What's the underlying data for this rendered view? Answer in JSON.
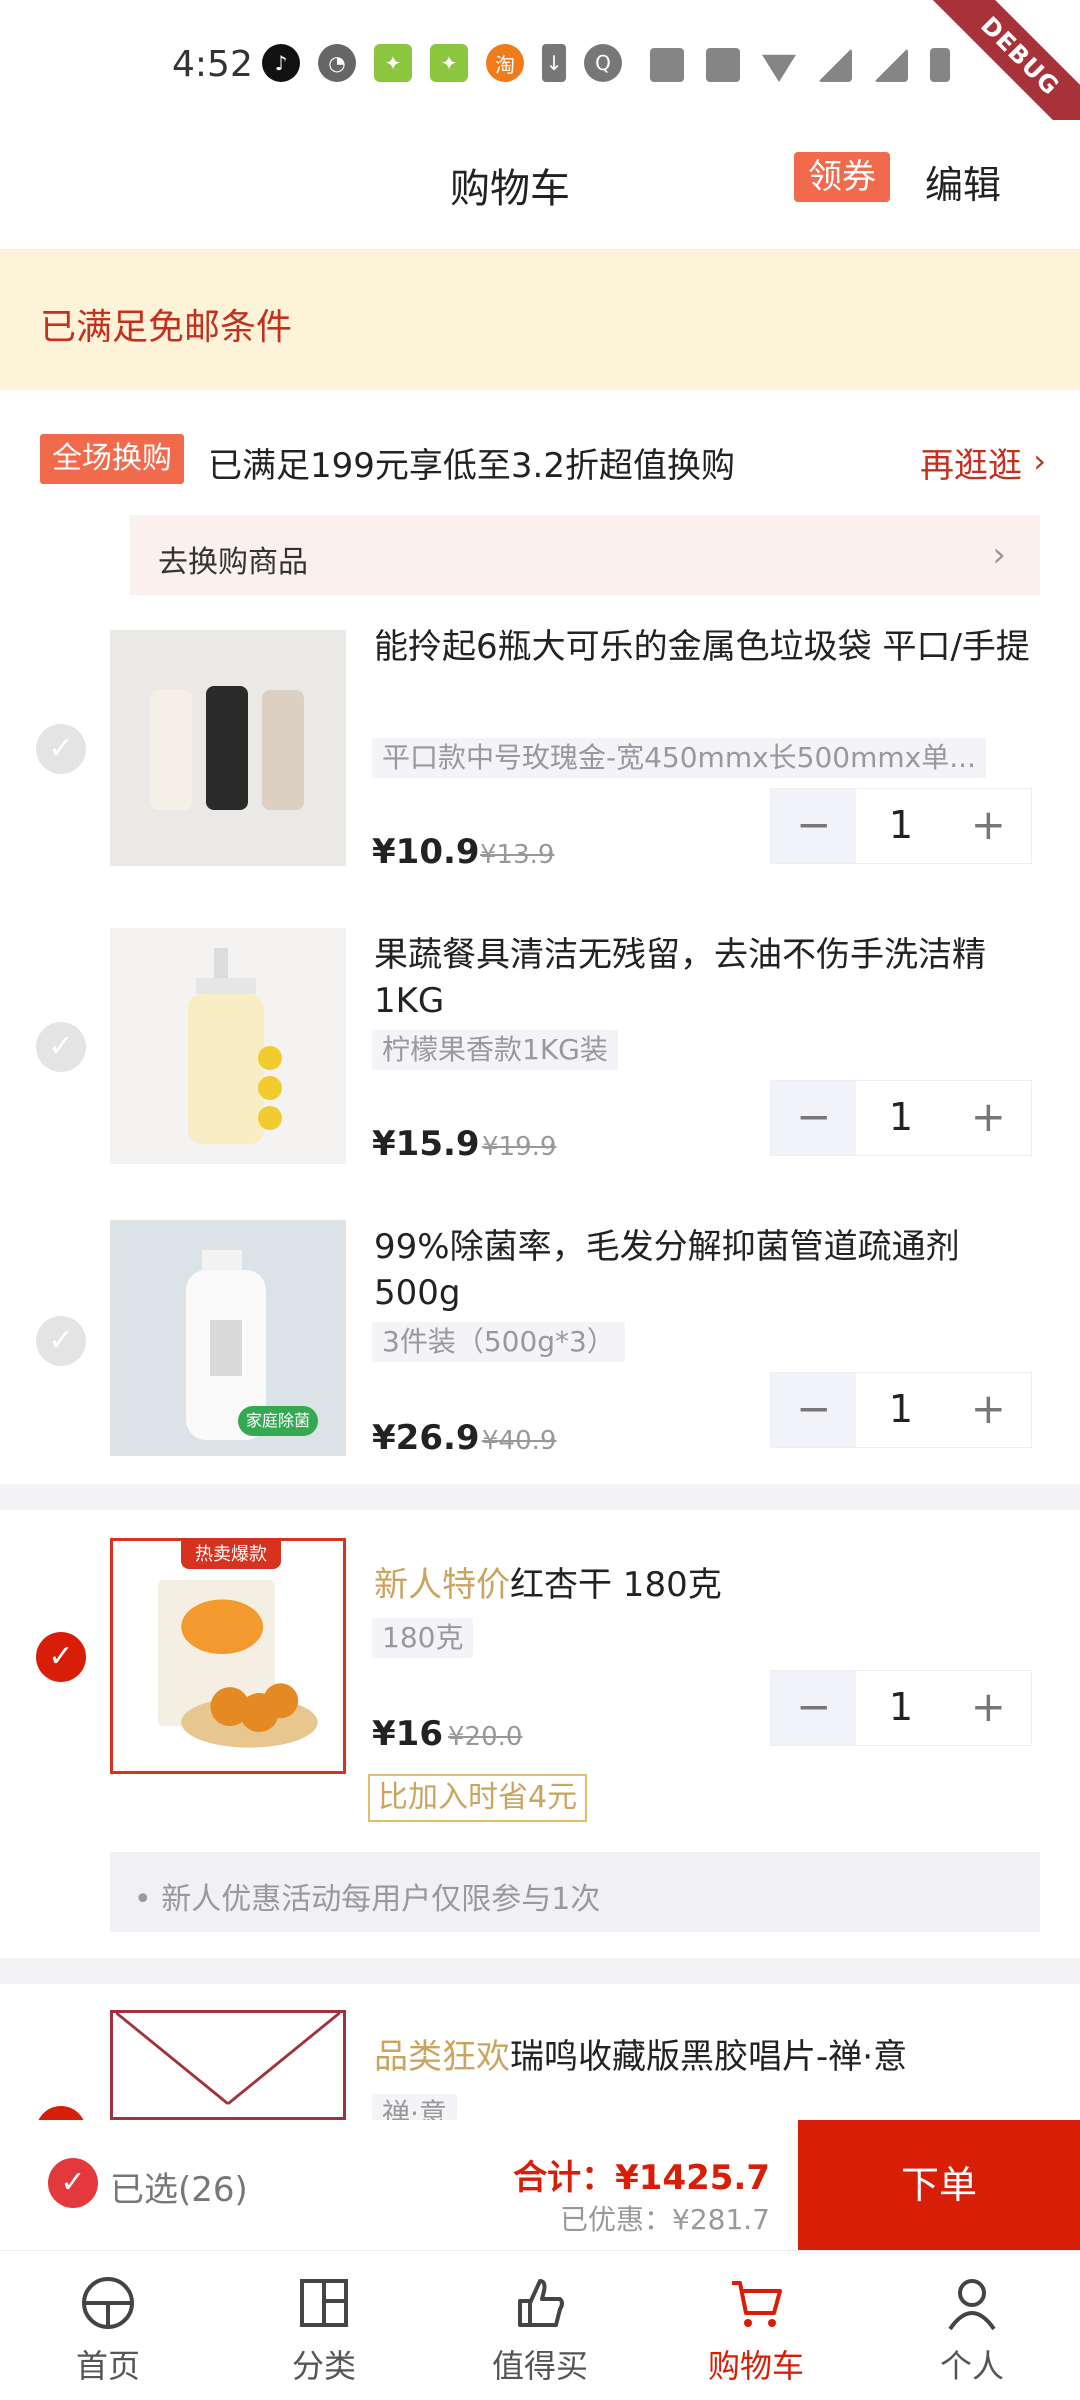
{
  "status_bar": {
    "time": "4:52",
    "debug": "DEBUG"
  },
  "header": {
    "title": "购物车",
    "coupon": "领券",
    "edit": "编辑"
  },
  "free_shipping": "已满足免邮条件",
  "exchange": {
    "badge": "全场换购",
    "text": "已满足199元享低至3.2折超值换购",
    "more": "再逛逛",
    "goto": "去换购商品"
  },
  "items": [
    {
      "title": "能拎起6瓶大可乐的金属色垃圾袋 平口/手提",
      "spec": "平口款中号玫瑰金-宽450mmx长500mmx单...",
      "price": "¥10.9",
      "orig": "¥13.9",
      "qty": "1",
      "checked": false
    },
    {
      "title": "果蔬餐具清洁无残留，去油不伤手洗洁精1KG",
      "spec": "柠檬果香款1KG装",
      "price": "¥15.9",
      "orig": "¥19.9",
      "qty": "1",
      "checked": false
    },
    {
      "title": "99%除菌率，毛发分解抑菌管道疏通剂500g",
      "spec": "3件装（500g*3）",
      "price": "¥26.9",
      "orig": "¥40.9",
      "qty": "1",
      "checked": false,
      "img_badge": "家庭除菌"
    },
    {
      "tag": "新人特价",
      "title": "红杏干 180克",
      "spec": "180克",
      "price": "¥16",
      "orig": "¥20.0",
      "qty": "1",
      "checked": true,
      "hot_badge": "热卖爆款",
      "save": "比加入时省4元",
      "note": "• 新人优惠活动每用户仅限参与1次"
    },
    {
      "tag": "品类狂欢",
      "title": "瑞鸣收藏版黑胶唱片-禅·意",
      "spec": "禅·意",
      "checked": true
    }
  ],
  "checkout": {
    "selected": "已选(26)",
    "total": "合计：¥1425.7",
    "discount": "已优惠：¥281.7",
    "order": "下单"
  },
  "tabs": [
    {
      "label": "首页",
      "icon": "home-icon"
    },
    {
      "label": "分类",
      "icon": "category-icon"
    },
    {
      "label": "值得买",
      "icon": "thumbs-up-icon"
    },
    {
      "label": "购物车",
      "icon": "cart-icon",
      "active": true
    },
    {
      "label": "个人",
      "icon": "person-icon"
    }
  ],
  "colors": {
    "accent": "#d81e06",
    "badge": "#f06a4b",
    "banner": "#fdf3d9",
    "gold": "#c9a55f"
  }
}
